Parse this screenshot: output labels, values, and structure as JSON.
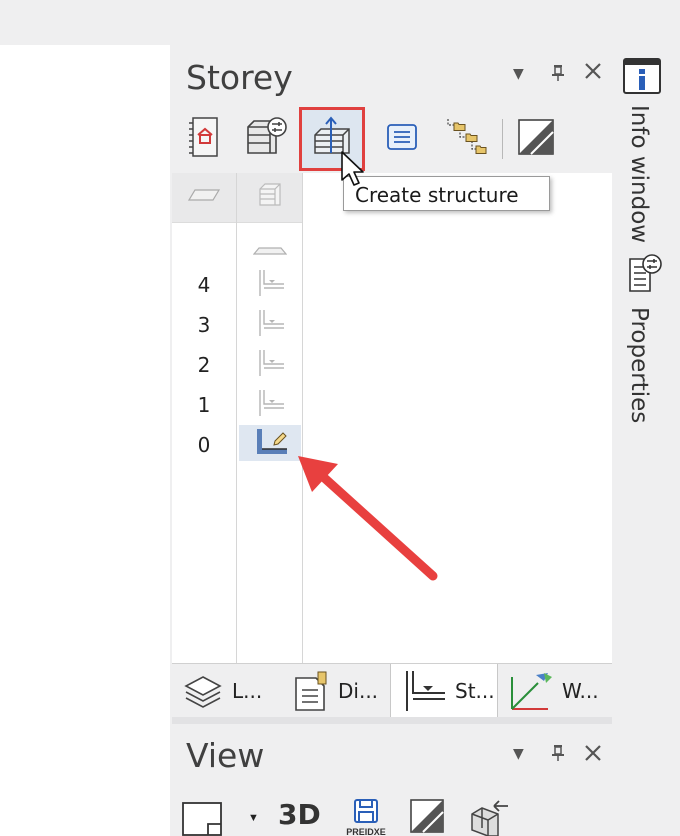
{
  "storey_panel": {
    "title": "Storey",
    "tooltip": "Create structure",
    "storeys": [
      "4",
      "3",
      "2",
      "1",
      "0"
    ]
  },
  "bottom_tabs": [
    {
      "label": "L...",
      "icon": "layers-icon"
    },
    {
      "label": "Di...",
      "icon": "document-icon"
    },
    {
      "label": "St...",
      "icon": "structure-icon"
    },
    {
      "label": "W...",
      "icon": "axes-icon"
    }
  ],
  "right_rail": {
    "info_window": "Info window",
    "properties": "Properties"
  },
  "view_panel": {
    "title": "View",
    "btn_3d": "3D",
    "save_label": "PREIDXE"
  },
  "colors": {
    "highlight_border": "#e0403f",
    "arrow": "#e8403f",
    "active_icon": "#5a7fb8"
  }
}
